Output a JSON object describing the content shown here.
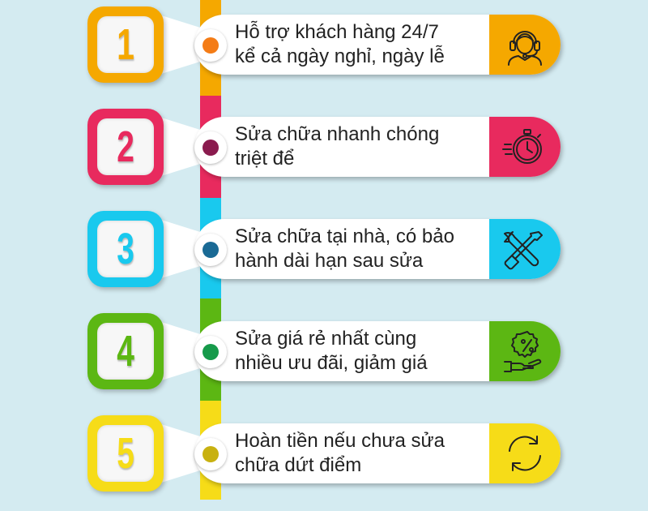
{
  "colors": {
    "background": "#d4ebf1",
    "orange": "#f5a800",
    "pink": "#e82a5e",
    "cyan": "#19c9ee",
    "green": "#5cb713",
    "yellow": "#f6dc18",
    "dot_orange": "#f47c16",
    "dot_maroon": "#8a1b4e",
    "dot_blue": "#1a6a95",
    "dot_green": "#169a4a",
    "dot_olive": "#c8b110"
  },
  "items": [
    {
      "number": "1",
      "line1": "Hỗ trợ khách hàng 24/7",
      "line2": "kể cả ngày nghỉ, ngày lễ",
      "icon": "headset-support-icon",
      "color": "#f5a800",
      "dot": "#f47c16"
    },
    {
      "number": "2",
      "line1": "Sửa chữa nhanh chóng",
      "line2": "triệt để",
      "icon": "stopwatch-icon",
      "color": "#e82a5e",
      "dot": "#8a1b4e"
    },
    {
      "number": "3",
      "line1": "Sửa chữa tại nhà, có bảo",
      "line2": "hành dài hạn sau sửa",
      "icon": "wrench-screwdriver-icon",
      "color": "#19c9ee",
      "dot": "#1a6a95"
    },
    {
      "number": "4",
      "line1": "Sửa giá rẻ nhất cùng",
      "line2": "nhiều ưu đãi, giảm giá",
      "icon": "discount-hand-icon",
      "color": "#5cb713",
      "dot": "#169a4a"
    },
    {
      "number": "5",
      "line1": "Hoàn tiền nếu chưa sửa",
      "line2": "chữa dứt điểm",
      "icon": "refund-cycle-icon",
      "color": "#f6dc18",
      "dot": "#c8b110"
    }
  ]
}
